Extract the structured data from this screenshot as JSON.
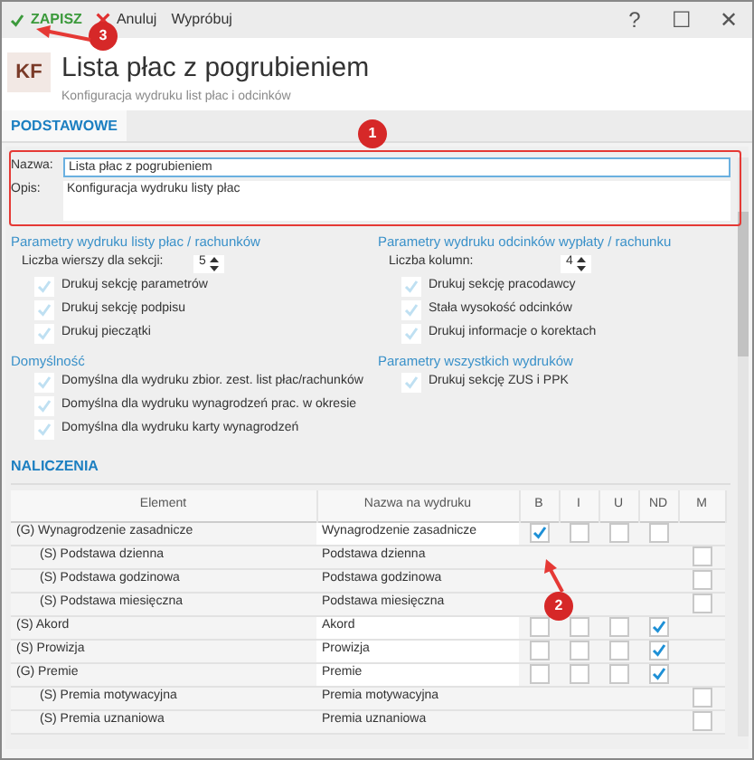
{
  "toolbar": {
    "buttons": [
      {
        "kind": "save",
        "label": "ZAPISZ"
      },
      {
        "kind": "cancel",
        "label": "Anuluj"
      },
      {
        "kind": "plain",
        "label": "Wypróbuj"
      }
    ],
    "window_controls": [
      "?",
      "☐",
      "✕"
    ]
  },
  "header": {
    "badge": "KF",
    "title": "Lista płac z pogrubieniem",
    "subtitle": "Konfiguracja wydruku list płac i odcinków"
  },
  "tabs": [
    {
      "label": "PODSTAWOWE",
      "selected": true
    }
  ],
  "form": {
    "name_label": "Nazwa:",
    "name_value": "Lista płac z pogrubieniem",
    "description_label": "Opis:",
    "description_value": "Konfiguracja wydruku listy płac"
  },
  "sections": [
    {
      "title": "Parametry wydruku listy płac / rachunków",
      "spinner": {
        "label": "Liczba wierszy dla sekcji:",
        "value": "5"
      },
      "options": [
        {
          "label": "Drukuj sekcję parametrów",
          "checked": true
        },
        {
          "label": "Drukuj sekcję podpisu",
          "checked": true
        },
        {
          "label": "Drukuj pieczątki",
          "checked": true
        }
      ]
    },
    {
      "title": "Parametry wydruku odcinków wypłaty / rachunku",
      "spinner": {
        "label": "Liczba kolumn:",
        "value": "4"
      },
      "options": [
        {
          "label": "Drukuj sekcję pracodawcy",
          "checked": true
        },
        {
          "label": "Stała wysokość odcinków",
          "checked": true
        },
        {
          "label": "Drukuj informacje o korektach",
          "checked": true
        }
      ]
    },
    {
      "title": "Domyślność",
      "options": [
        {
          "label": "Domyślna dla wydruku zbior. zest. list płac/rachunków",
          "checked": true
        },
        {
          "label": "Domyślna dla wydruku wynagrodzeń prac. w okresie",
          "checked": true
        },
        {
          "label": "Domyślna dla wydruku karty wynagrodzeń",
          "checked": true
        }
      ]
    },
    {
      "title": "Parametry wszystkich wydruków",
      "options": [
        {
          "label": "Drukuj sekcję ZUS i PPK",
          "checked": true
        }
      ]
    }
  ],
  "naliczenia": {
    "title": "NALICZENIA",
    "columns": [
      "Element",
      "Nazwa na wydruku",
      "B",
      "I",
      "U",
      "ND",
      "M"
    ],
    "rows": [
      {
        "element": "(G) Wynagrodzenie zasadnicze",
        "print_name": "Wynagrodzenie zasadnicze",
        "flags": {
          "b": true,
          "i": false,
          "u": false,
          "nd": false
        },
        "children": [
          {
            "element": "(S) Podstawa dzienna",
            "print_name": "Podstawa dzienna",
            "flags": {
              "m": false
            }
          },
          {
            "element": "(S) Podstawa godzinowa",
            "print_name": "Podstawa godzinowa",
            "flags": {
              "m": false
            }
          },
          {
            "element": "(S) Podstawa miesięczna",
            "print_name": "Podstawa miesięczna",
            "flags": {
              "m": false
            }
          }
        ]
      },
      {
        "element": "(S) Akord",
        "print_name": "Akord",
        "flags": {
          "b": false,
          "i": false,
          "u": false,
          "nd": true
        }
      },
      {
        "element": "(S) Prowizja",
        "print_name": "Prowizja",
        "flags": {
          "b": false,
          "i": false,
          "u": false,
          "nd": true
        }
      },
      {
        "element": "(G) Premie",
        "print_name": "Premie",
        "flags": {
          "b": false,
          "i": false,
          "u": false,
          "nd": true
        },
        "children": [
          {
            "element": "(S) Premia motywacyjna",
            "print_name": "Premia motywacyjna",
            "flags": {
              "m": false
            }
          },
          {
            "element": "(S) Premia uznaniowa",
            "print_name": "Premia uznaniowa",
            "flags": {
              "m": false
            }
          }
        ]
      }
    ]
  },
  "callouts": [
    {
      "label": "1"
    },
    {
      "label": "2"
    },
    {
      "label": "3"
    }
  ]
}
